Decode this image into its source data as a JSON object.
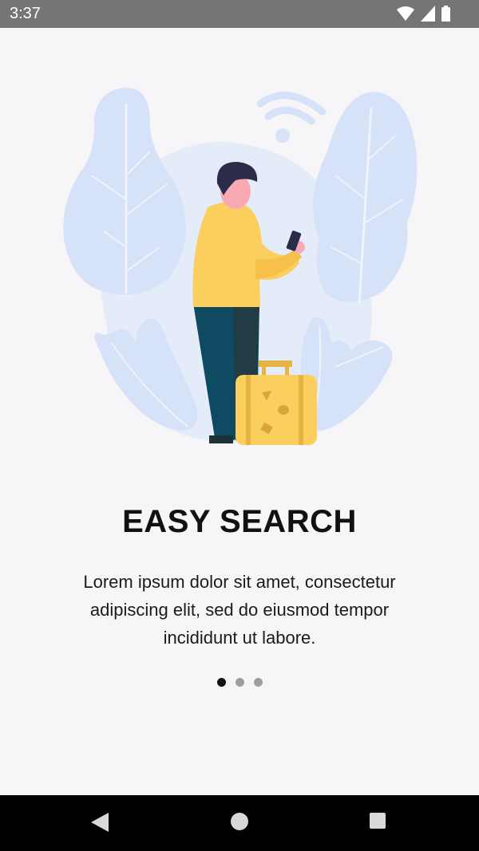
{
  "status_bar": {
    "time": "3:37",
    "icons": [
      "wifi-icon",
      "signal-icon",
      "battery-icon"
    ]
  },
  "onboarding": {
    "title": "EASY SEARCH",
    "description": "Lorem ipsum dolor sit amet, consectetur adipiscing elit, sed do eiusmod tempor incididunt ut labore.",
    "page_indicator": {
      "current": 1,
      "total": 3
    }
  },
  "nav_bar": {
    "buttons": [
      "back-icon",
      "home-icon",
      "recents-icon"
    ]
  },
  "colors": {
    "background": "#f7f5f8",
    "leaf": "#d6e2f8",
    "shirt": "#fbcf5e",
    "pants": "#0f4a63",
    "hair": "#2b2b4a",
    "skin": "#f8a9b4",
    "suitcase": "#fbcf5e"
  }
}
